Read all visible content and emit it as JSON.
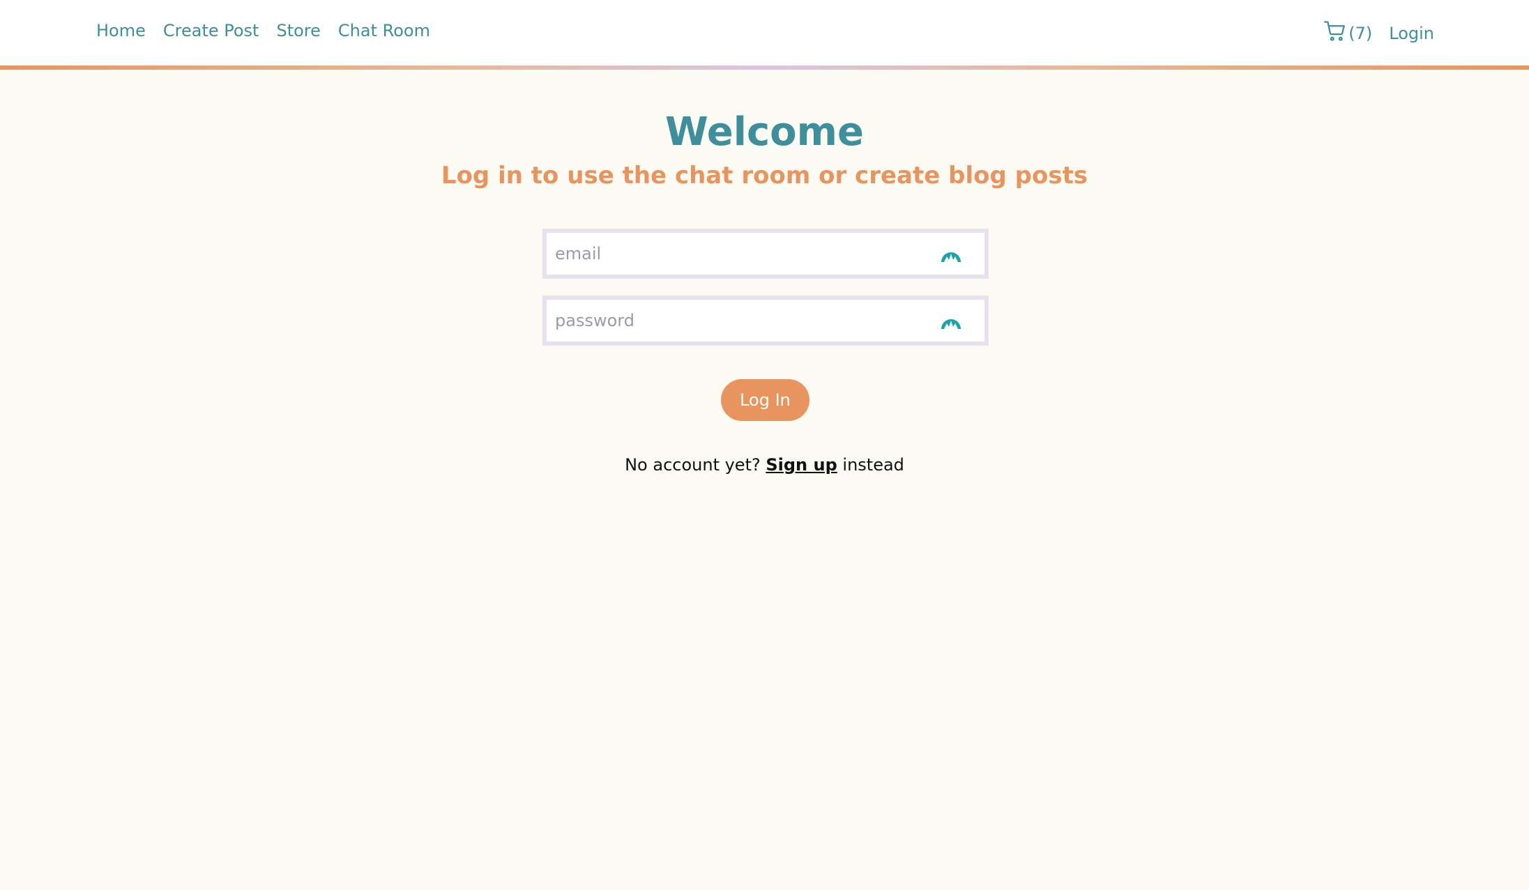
{
  "nav": {
    "links": [
      "Home",
      "Create Post",
      "Store",
      "Chat Room"
    ],
    "cart_count": "(7)",
    "login_label": "Login"
  },
  "main": {
    "title": "Welcome",
    "subtitle": "Log in to use the chat room or create blog posts"
  },
  "form": {
    "email_placeholder": "email",
    "password_placeholder": "password",
    "submit_label": "Log In"
  },
  "signup": {
    "prefix": "No account yet?",
    "link": "Sign up",
    "suffix": "instead"
  },
  "colors": {
    "accent_teal": "#3e8e9c",
    "accent_orange": "#e8945f",
    "background": "#fbfaf3",
    "field_border": "#e7e0ef",
    "password_manager_icon": "#1aa3a8"
  }
}
